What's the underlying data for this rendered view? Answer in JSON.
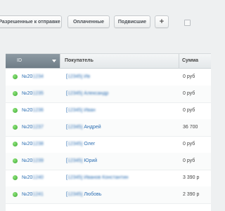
{
  "toolbar": {
    "filter_allowed": "Разрешенные к отправке",
    "filter_paid": "Оплаченные",
    "filter_signed": "Подвисшие",
    "add_label": "+"
  },
  "table": {
    "columns": {
      "id": "ID",
      "buyer": "Покупатель",
      "amount": "Сумма"
    },
    "rows": [
      {
        "id": "№20",
        "id_blur": "1234",
        "buyer_pre": "[",
        "buyer_blur": "12345] Ив",
        "buyer_name": "",
        "buyer_tail": "",
        "amount": "0 руб"
      },
      {
        "id": "№20",
        "id_blur": "1235",
        "buyer_pre": "[",
        "buyer_blur": "12345] Александр",
        "buyer_name": "",
        "buyer_tail": "",
        "amount": "0 руб"
      },
      {
        "id": "№20",
        "id_blur": "1236",
        "buyer_pre": "[",
        "buyer_blur": "12345] Иван",
        "buyer_name": "",
        "buyer_tail": "",
        "amount": "0 руб"
      },
      {
        "id": "№20",
        "id_blur": "1237",
        "buyer_pre": "[",
        "buyer_blur": "12345]",
        "buyer_name": "Андрей",
        "buyer_tail": "",
        "amount": "36 700"
      },
      {
        "id": "№20",
        "id_blur": "1238",
        "buyer_pre": "[",
        "buyer_blur": "12345]",
        "buyer_name": "Олег",
        "buyer_tail": "",
        "amount": "0 руб"
      },
      {
        "id": "№20",
        "id_blur": "1239",
        "buyer_pre": "[",
        "buyer_blur": "12345]",
        "buyer_name": "Юрий",
        "buyer_tail": "",
        "amount": "0 руб"
      },
      {
        "id": "№20",
        "id_blur": "1240",
        "buyer_pre": "[",
        "buyer_blur": "12345] Иванов Константин",
        "buyer_name": "",
        "buyer_tail": "",
        "amount": "3 390 р"
      },
      {
        "id": "№20",
        "id_blur": "1241",
        "buyer_pre": "[",
        "buyer_blur": "12345]",
        "buyer_name": "Любовь",
        "buyer_tail": "",
        "amount": "2 390 р"
      }
    ]
  },
  "colors": {
    "accent_link": "#2d6fb3",
    "status_paid": "#3da834",
    "header_active": "#7a8892"
  }
}
